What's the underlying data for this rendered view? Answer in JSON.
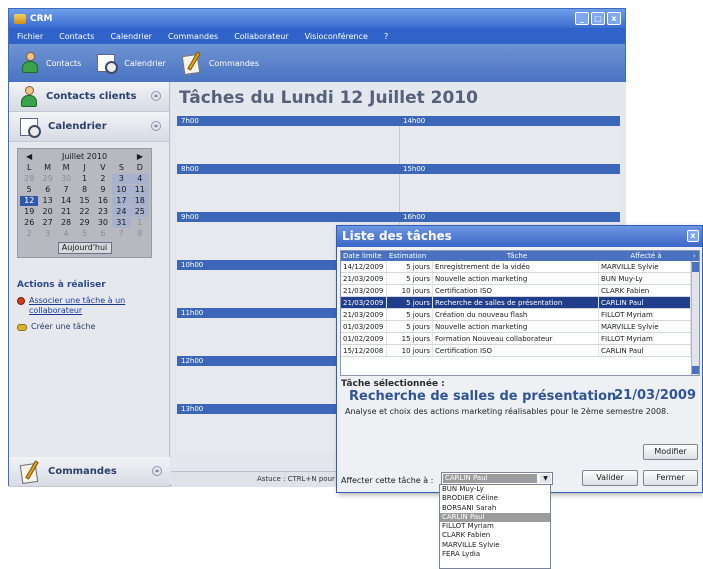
{
  "window": {
    "title": "CRM"
  },
  "menu": [
    "Fichier",
    "Contacts",
    "Calendrier",
    "Commandes",
    "Collaborateur",
    "Visioconférence",
    "?"
  ],
  "toolbar": {
    "contacts": "Contacts",
    "calendar": "Calendrier",
    "orders": "Commandes"
  },
  "sidebar": {
    "contacts": "Contacts clients",
    "calendar": "Calendrier",
    "orders": "Commandes",
    "calendar_widget": {
      "month": "Juillet 2010",
      "weekdays": [
        "L",
        "M",
        "M",
        "J",
        "V",
        "S",
        "D"
      ],
      "weeks": [
        [
          "28",
          "29",
          "30",
          "1",
          "2",
          "3",
          "4"
        ],
        [
          "5",
          "6",
          "7",
          "8",
          "9",
          "10",
          "11"
        ],
        [
          "12",
          "13",
          "14",
          "15",
          "16",
          "17",
          "18"
        ],
        [
          "19",
          "20",
          "21",
          "22",
          "23",
          "24",
          "25"
        ],
        [
          "26",
          "27",
          "28",
          "29",
          "30",
          "31",
          "1"
        ],
        [
          "2",
          "3",
          "4",
          "5",
          "6",
          "7",
          "8"
        ]
      ],
      "selected_day": "12",
      "today_label": "Aujourd'hui"
    },
    "actions_title": "Actions à réaliser",
    "action_assign": "Associer une tâche à un collaborateur",
    "action_create": "Créer une tâche"
  },
  "main": {
    "title": "Tâches du Lundi 12 Juillet 2010",
    "slots": [
      [
        "7h00",
        "14h00"
      ],
      [
        "8h00",
        "15h00"
      ],
      [
        "9h00",
        "16h00"
      ],
      [
        "10h00",
        ""
      ],
      [
        "11h00",
        ""
      ],
      [
        "12h00",
        ""
      ],
      [
        "13h00",
        ""
      ]
    ],
    "status": "Astuce : CTRL+N pour a"
  },
  "dialog": {
    "title": "Liste des tâches",
    "columns": [
      "Date limite",
      "Estimation",
      "Tâche",
      "Affecté à"
    ],
    "rows": [
      [
        "14/12/2009",
        "5 jours",
        "Enregistrement de la vidéo",
        "MARVILLE Sylvie"
      ],
      [
        "21/03/2009",
        "5 jours",
        "Nouvelle action marketing",
        "BUN Muy-Ly"
      ],
      [
        "21/03/2009",
        "10 jours",
        "Certification ISO",
        "CLARK Fabien"
      ],
      [
        "21/03/2009",
        "5 jours",
        "Recherche de salles de présentation",
        "CARLIN Paul"
      ],
      [
        "21/03/2009",
        "5 jours",
        "Création du nouveau flash",
        "FILLOT Myriam"
      ],
      [
        "01/03/2009",
        "5 jours",
        "Nouvelle action marketing",
        "MARVILLE Sylvie"
      ],
      [
        "01/02/2009",
        "15 jours",
        "Formation Nouveau collaborateur",
        "FILLOT Myriam"
      ],
      [
        "15/12/2008",
        "10 jours",
        "Certification ISO",
        "CARLIN Paul"
      ]
    ],
    "selected_index": 3,
    "selected_label": "Tâche sélectionnée :",
    "selected_task": "Recherche de salles de présentation",
    "selected_date": "21/03/2009",
    "selected_desc": "Analyse et choix des actions marketing réalisables pour le 2ème semestre 2008.",
    "modify_label": "Modifier",
    "assign_label": "Affecter cette tâche à :",
    "assign_value": "CARLIN Paul",
    "validate_label": "Valider",
    "close_label": "Fermer"
  },
  "dropdown_options": [
    "BUN Muy-Ly",
    "BRODIER Céline",
    "BORSANI Sarah",
    "CARLIN Paul",
    "FILLOT Myriam",
    "CLARK Fabien",
    "MARVILLE Sylvie",
    "FERA Lydia"
  ]
}
